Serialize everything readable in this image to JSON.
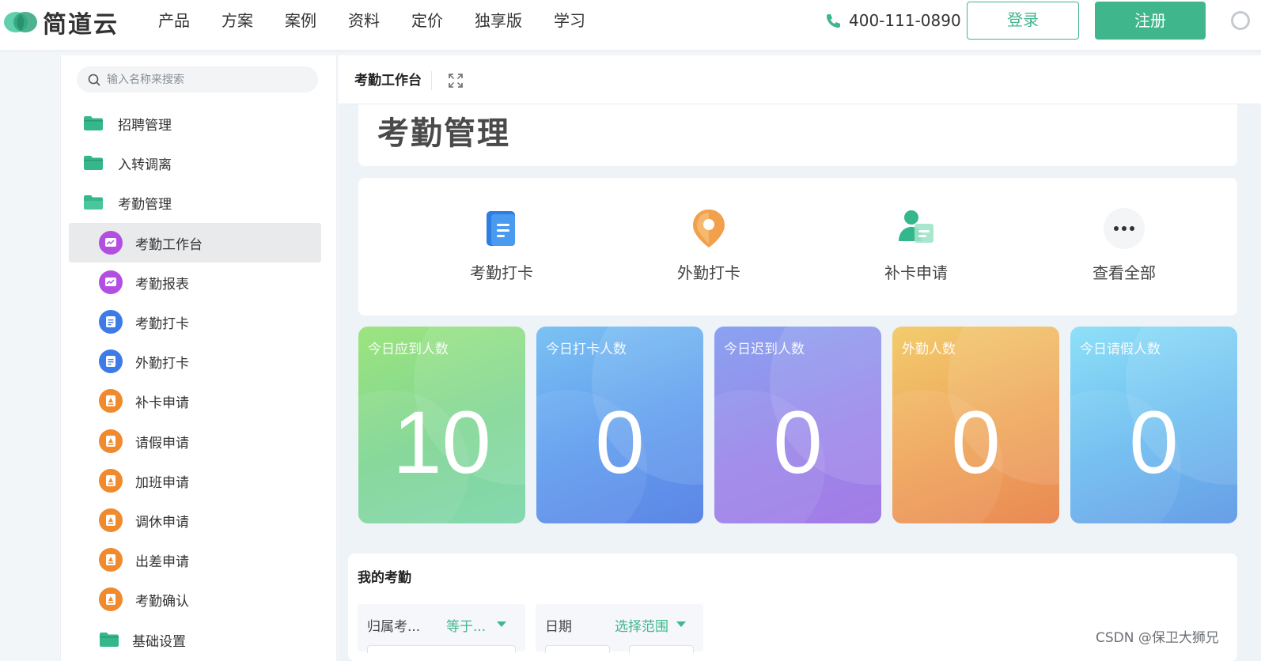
{
  "brand": {
    "name": "简道云",
    "accent": "#3fb68b"
  },
  "nav": {
    "items": [
      "产品",
      "方案",
      "案例",
      "资料",
      "定价",
      "独享版",
      "学习"
    ]
  },
  "header": {
    "phone": "400-111-0890",
    "login_label": "登录",
    "register_label": "注册"
  },
  "sidebar": {
    "search_placeholder": "输入名称来搜索",
    "items": [
      {
        "label": "招聘管理",
        "type": "folder",
        "icon": "folder-icon"
      },
      {
        "label": "入转调离",
        "type": "folder",
        "icon": "folder-icon"
      },
      {
        "label": "考勤管理",
        "type": "folder-open",
        "icon": "folder-open-icon"
      },
      {
        "label": "考勤工作台",
        "type": "sub",
        "icon": "dashboard-icon",
        "color": "#b34fe0",
        "active": true
      },
      {
        "label": "考勤报表",
        "type": "sub",
        "icon": "report-icon",
        "color": "#b34fe0"
      },
      {
        "label": "考勤打卡",
        "type": "sub",
        "icon": "form-icon",
        "color": "#3d7be8"
      },
      {
        "label": "外勤打卡",
        "type": "sub",
        "icon": "form-icon",
        "color": "#3d7be8"
      },
      {
        "label": "补卡申请",
        "type": "sub",
        "icon": "approval-icon",
        "color": "#f08a2e"
      },
      {
        "label": "请假申请",
        "type": "sub",
        "icon": "approval-icon",
        "color": "#f08a2e"
      },
      {
        "label": "加班申请",
        "type": "sub",
        "icon": "approval-icon",
        "color": "#f08a2e"
      },
      {
        "label": "调休申请",
        "type": "sub",
        "icon": "approval-icon",
        "color": "#f08a2e"
      },
      {
        "label": "出差申请",
        "type": "sub",
        "icon": "approval-icon",
        "color": "#f08a2e"
      },
      {
        "label": "考勤确认",
        "type": "sub",
        "icon": "approval-icon",
        "color": "#f08a2e"
      },
      {
        "label": "基础设置",
        "type": "subfolder",
        "icon": "folder-icon"
      }
    ]
  },
  "main": {
    "tab_title": "考勤工作台",
    "page_title": "考勤管理",
    "shortcuts": [
      {
        "label": "考勤打卡",
        "icon": "clock-in-icon"
      },
      {
        "label": "外勤打卡",
        "icon": "location-pin-icon"
      },
      {
        "label": "补卡申请",
        "icon": "user-card-icon"
      },
      {
        "label": "查看全部",
        "icon": "more-icon"
      }
    ],
    "stats": [
      {
        "label": "今日应到人数",
        "value": "10"
      },
      {
        "label": "今日打卡人数",
        "value": "0"
      },
      {
        "label": "今日迟到人数",
        "value": "0"
      },
      {
        "label": "外勤人数",
        "value": "0"
      },
      {
        "label": "今日请假人数",
        "value": "0"
      }
    ],
    "my_attendance": {
      "title": "我的考勤",
      "filters": [
        {
          "label": "归属考...",
          "value": "等于..."
        },
        {
          "label": "日期",
          "value": "选择范围"
        }
      ]
    }
  },
  "watermark": "CSDN @保卫大狮兄"
}
